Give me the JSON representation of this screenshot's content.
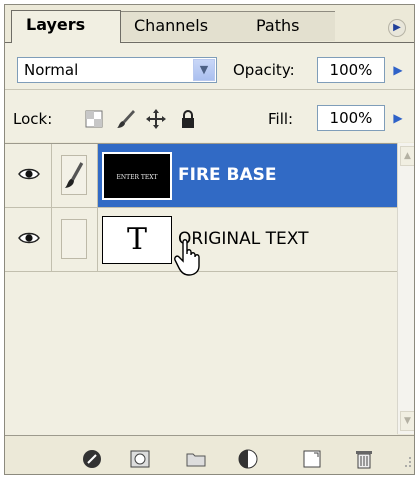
{
  "tabs": [
    {
      "label": "Layers"
    },
    {
      "label": "Channels"
    },
    {
      "label": "Paths"
    }
  ],
  "blend_mode": {
    "value": "Normal"
  },
  "opacity": {
    "label": "Opacity:",
    "value": "100%"
  },
  "lock": {
    "label": "Lock:"
  },
  "fill": {
    "label": "Fill:",
    "value": "100%"
  },
  "layers": [
    {
      "name": "FIRE BASE",
      "thumb_text": "ENTER TEXT",
      "selected": true
    },
    {
      "name": "ORIGINAL TEXT",
      "thumb_text": "T",
      "selected": false
    }
  ],
  "colors": {
    "selection": "#316ac5",
    "panel": "#ece9d8"
  },
  "icons": [
    "panel-menu-icon",
    "lock-transparent-icon",
    "lock-image-icon",
    "lock-position-icon",
    "lock-all-icon",
    "eye-icon",
    "brush-icon",
    "link-layers-icon",
    "layer-style-icon",
    "layer-mask-icon",
    "new-group-icon",
    "adjustment-layer-icon",
    "new-layer-icon",
    "trash-icon",
    "hand-cursor-icon"
  ]
}
